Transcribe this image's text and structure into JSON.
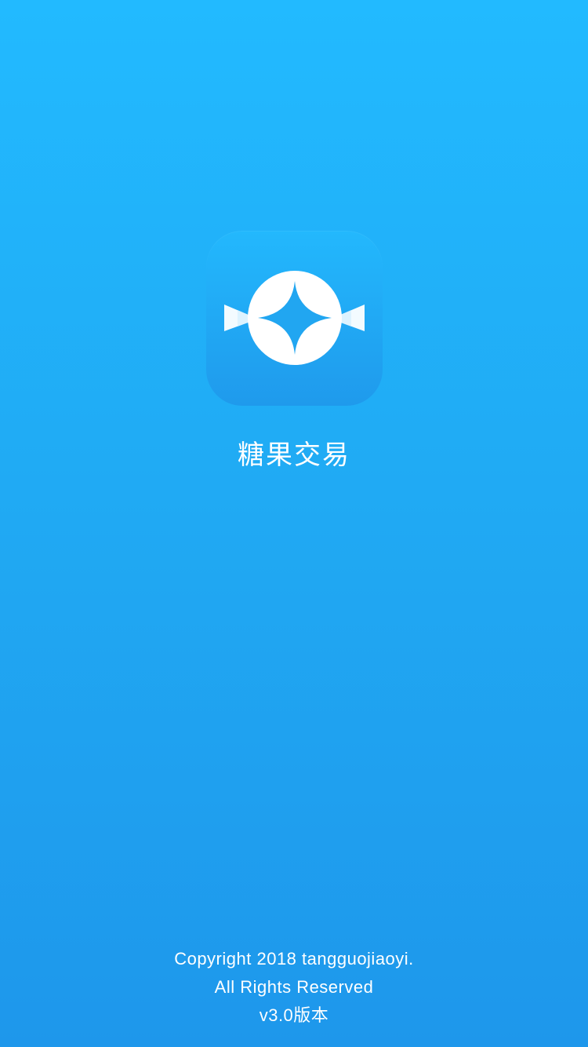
{
  "app": {
    "name": "糖果交易",
    "icon": "candy-logo-icon"
  },
  "footer": {
    "copyright": "Copyright 2018 tangguojiaoyi.",
    "rights": "All Rights Reserved",
    "version": "v3.0版本"
  },
  "colors": {
    "background_top": "#22BAFF",
    "background_bottom": "#1E97EB",
    "icon_tile": "#20A8F4",
    "text": "#FFFFFF"
  }
}
